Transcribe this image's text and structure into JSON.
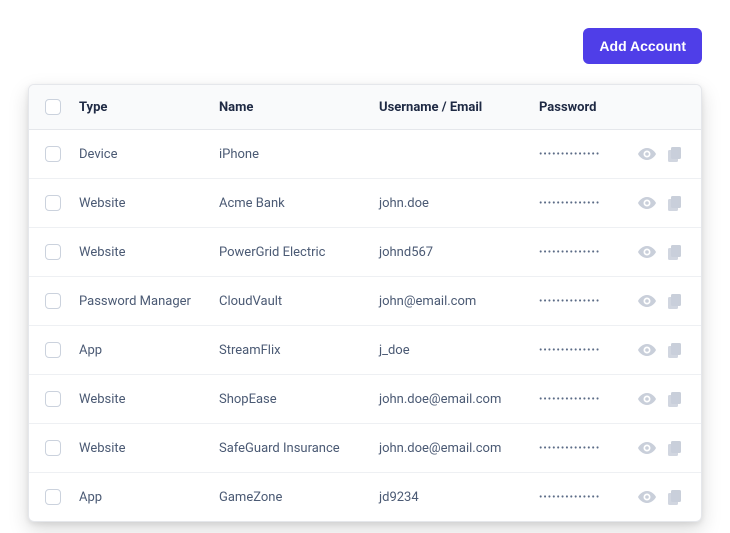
{
  "toolbar": {
    "add_account_label": "Add Account"
  },
  "table": {
    "headers": {
      "type": "Type",
      "name": "Name",
      "username": "Username / Email",
      "password": "Password"
    },
    "password_mask": "••••••••••••••",
    "rows": [
      {
        "type": "Device",
        "name": "iPhone",
        "username": ""
      },
      {
        "type": "Website",
        "name": "Acme Bank",
        "username": "john.doe"
      },
      {
        "type": "Website",
        "name": "PowerGrid Electric",
        "username": "johnd567"
      },
      {
        "type": "Password Manager",
        "name": "CloudVault",
        "username": "john@email.com"
      },
      {
        "type": "App",
        "name": "StreamFlix",
        "username": "j_doe"
      },
      {
        "type": "Website",
        "name": "ShopEase",
        "username": "john.doe@email.com"
      },
      {
        "type": "Website",
        "name": "SafeGuard Insurance",
        "username": "john.doe@email.com"
      },
      {
        "type": "App",
        "name": "GameZone",
        "username": "jd9234"
      }
    ]
  },
  "icons": {
    "eye": "eye-icon",
    "copy": "copy-icon"
  },
  "colors": {
    "accent": "#4f3ee8",
    "header_text": "#1f2a44",
    "body_text": "#4b5a74",
    "icon_muted": "#c9cfda"
  }
}
